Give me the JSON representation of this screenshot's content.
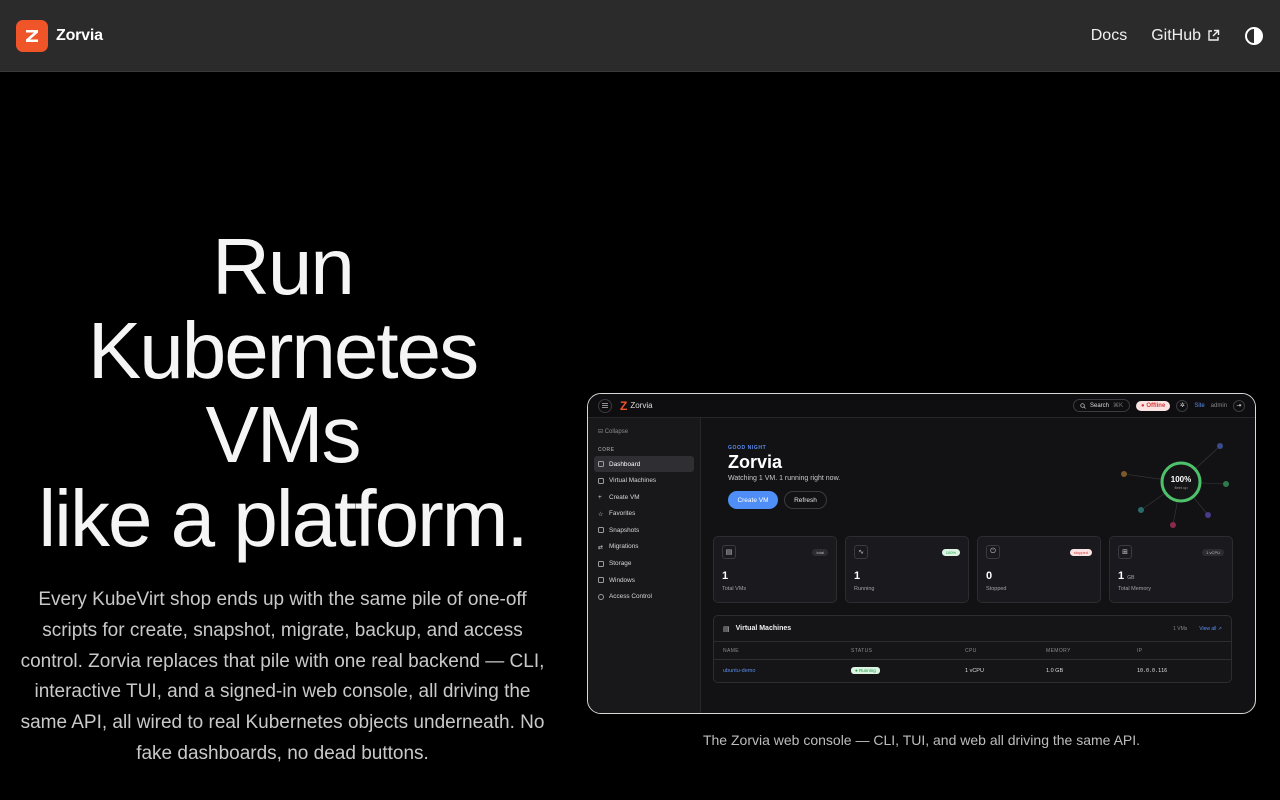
{
  "nav": {
    "brand": "Zorvia",
    "logo_letter": "Z",
    "docs": "Docs",
    "github": "GitHub"
  },
  "hero": {
    "title_lines": [
      "Run",
      "Kubernetes",
      "VMs",
      "like a platform."
    ],
    "description": "Every KubeVirt shop ends up with the same pile of one-off scripts for create, snapshot, migrate, backup, and access control. Zorvia replaces that pile with one real backend — CLI, interactive TUI, and a signed-in web console, all driving the same API, all wired to real Kubernetes objects underneath. No fake dashboards, no dead buttons."
  },
  "preview": {
    "caption": "The Zorvia web console — CLI, TUI, and web all driving the same API.",
    "topbar": {
      "brand": "Zorvia",
      "search": "Search",
      "shortcut": "⌘K",
      "offline": "Offline",
      "site": "Site",
      "user": "admin"
    },
    "sidebar": {
      "collapse": "Collapse",
      "section": "CORE",
      "items": [
        {
          "label": "Dashboard",
          "active": true
        },
        {
          "label": "Virtual Machines"
        },
        {
          "label": "Create VM"
        },
        {
          "label": "Favorites"
        },
        {
          "label": "Snapshots"
        },
        {
          "label": "Migrations"
        },
        {
          "label": "Storage"
        },
        {
          "label": "Windows"
        },
        {
          "label": "Access Control"
        }
      ]
    },
    "header": {
      "greeting": "GOOD NIGHT",
      "title": "Zorvia",
      "subtitle": "Watching 1 VM. 1 running right now.",
      "create_button": "Create VM",
      "refresh_button": "Refresh",
      "ring_value": "100%",
      "ring_label": "fleet up",
      "ring_fraction": 1.0
    },
    "cards": [
      {
        "value": "1",
        "unit": "",
        "label": "Total VMs",
        "pill": "total"
      },
      {
        "value": "1",
        "unit": "",
        "label": "Running",
        "pill": "100%"
      },
      {
        "value": "0",
        "unit": "",
        "label": "Stopped",
        "pill": "stopped"
      },
      {
        "value": "1",
        "unit": "GB",
        "label": "Total Memory",
        "pill": "1 vCPU"
      }
    ],
    "table": {
      "title": "Virtual Machines",
      "count": "1 VMs",
      "view_all": "View all ↗",
      "columns": [
        "NAME",
        "STATUS",
        "CPU",
        "MEMORY",
        "IP"
      ],
      "rows": [
        {
          "name": "ubuntu-demo",
          "status": "Running",
          "cpu": "1 vCPU",
          "memory": "1.0 GB",
          "ip": "10.0.0.116"
        }
      ]
    },
    "colors": {
      "accent": "#4f8ef7",
      "brand": "#f0552a",
      "success": "#1f9c4a",
      "danger": "#d43c3c"
    }
  }
}
